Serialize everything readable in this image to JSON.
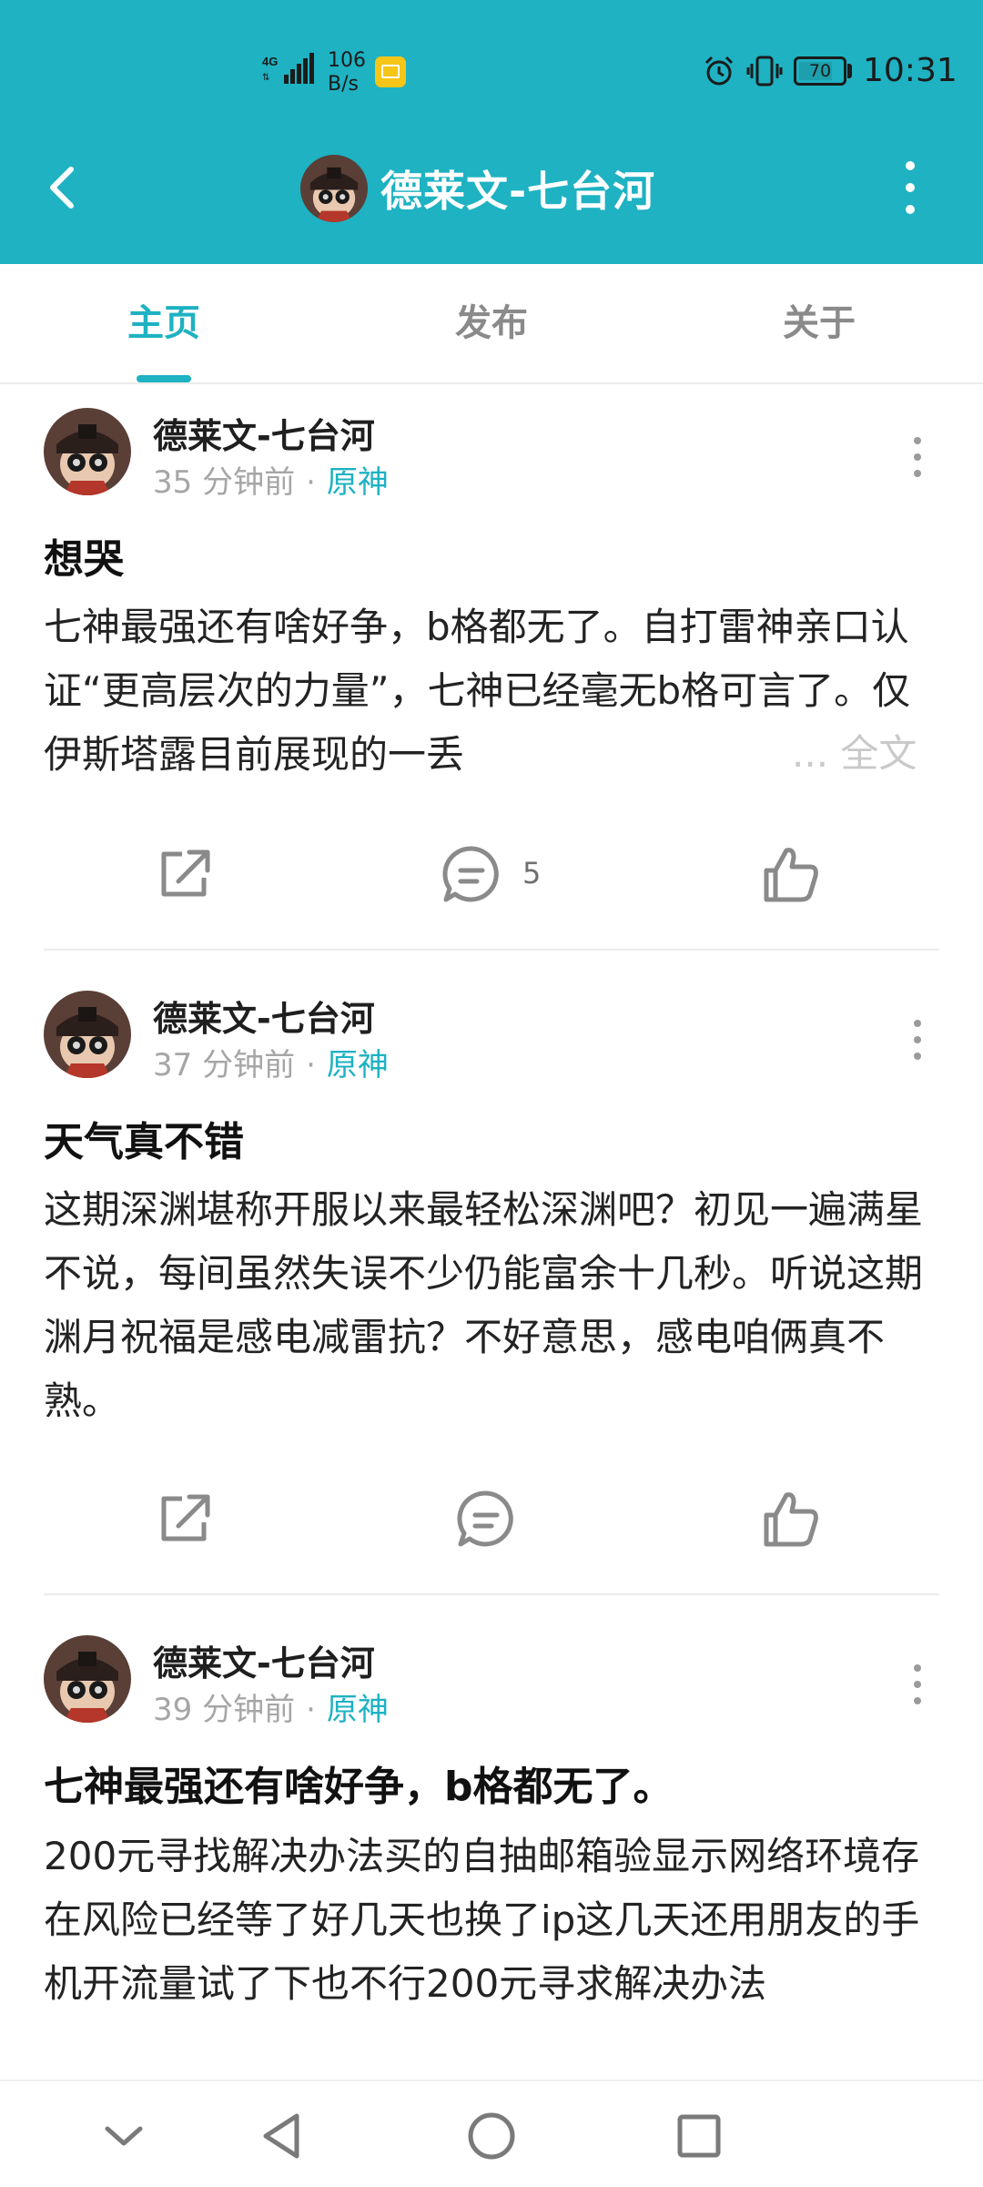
{
  "status_bar": {
    "network": "4G",
    "speed_value": "106",
    "speed_unit": "B/s",
    "battery": "70",
    "time": "10:31",
    "icons": [
      "signal-icon",
      "mail-icon",
      "alarm-icon",
      "vibrate-icon",
      "battery-icon"
    ]
  },
  "header": {
    "title": "德莱文-七台河",
    "colors": {
      "accent": "#1eb2c2"
    }
  },
  "tabs": [
    {
      "label": "主页",
      "active": true
    },
    {
      "label": "发布",
      "active": false
    },
    {
      "label": "关于",
      "active": false
    }
  ],
  "posts": [
    {
      "author": "德莱文-七台河",
      "time": "35 分钟前",
      "tag": "原神",
      "title": "想哭",
      "body": "七神最强还有啥好争，b格都无了。自打雷神亲口认证“更高层次的力量”，七神已经毫无b格可言了。仅伊斯塔露目前展现的一丢",
      "more": "... 全文",
      "comment_count": "5"
    },
    {
      "author": "德莱文-七台河",
      "time": "37 分钟前",
      "tag": "原神",
      "title": "天气真不错",
      "body": "这期深渊堪称开服以来最轻松深渊吧？初见一遍满星不说，每间虽然失误不少仍能富余十几秒。听说这期渊月祝福是感电减雷抗？不好意思，感电咱俩真不熟。",
      "comment_count": ""
    },
    {
      "author": "德莱文-七台河",
      "time": "39 分钟前",
      "tag": "原神",
      "title": "七神最强还有啥好争，b格都无了。",
      "body": "200元寻找解决办法买的自抽邮箱验显示网络环境存在风险已经等了好几天也换了ip这几天还用朋友的手机开流量试了下也不行200元寻求解决办法"
    }
  ]
}
